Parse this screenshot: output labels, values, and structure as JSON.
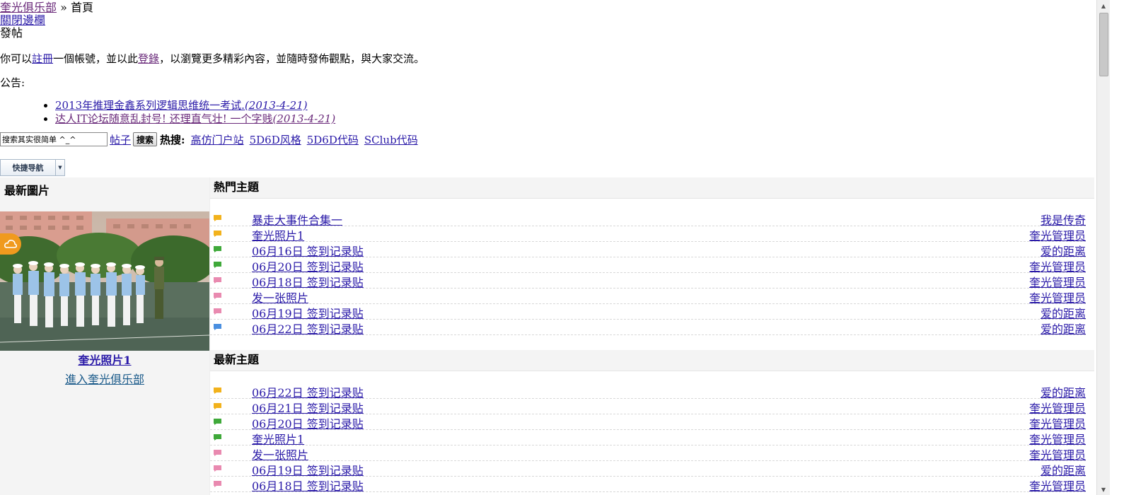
{
  "breadcrumb": {
    "home": "奎光俱乐部",
    "separator": "»",
    "current": "首頁"
  },
  "top_links": {
    "close_sidebar": "關閉邊欄",
    "post": "發帖"
  },
  "welcome": {
    "before": "你可以",
    "register": "註冊",
    "middle": "一個帳號，並以此",
    "login": "登錄",
    "after": "，以瀏覽更多精彩內容，並隨時發佈觀點，與大家交流。"
  },
  "notice": {
    "label": "公告:",
    "items": [
      {
        "text": "2013年推理金鑫系列逻辑思维统一考试.",
        "date": "(2013-4-21)"
      },
      {
        "text": "达人IT论坛随意乱封号! 还理直气壮! 一个字贱",
        "date": "(2013-4-21)"
      }
    ]
  },
  "search": {
    "value": "搜索其实很简单 ^_^",
    "scope": "帖子",
    "button": "搜索",
    "hot_label": "热搜:",
    "hot_terms": [
      "高仿门户站",
      "5D6D风格",
      "5D6D代码",
      "SClub代码"
    ]
  },
  "quick_nav": {
    "label": "快捷导航"
  },
  "left_panel": {
    "title": "最新圖片",
    "photo_caption": "奎光照片1",
    "enter_link": "進入奎光俱乐部"
  },
  "hot_topics": {
    "title": "熱門主題",
    "rows": [
      {
        "title": "暴走大事件合集一",
        "author": "我是传奇",
        "icon_color": "#f2b21c"
      },
      {
        "title": "奎光照片1",
        "author": "奎光管理员",
        "icon_color": "#f2b21c"
      },
      {
        "title": "06月16日 签到记录贴",
        "author": "爱的距离",
        "icon_color": "#3fa93a"
      },
      {
        "title": "06月20日 签到记录贴",
        "author": "奎光管理员",
        "icon_color": "#3fa93a"
      },
      {
        "title": "06月18日 签到记录贴",
        "author": "奎光管理员",
        "icon_color": "#e98ab0"
      },
      {
        "title": "发一张照片",
        "author": "奎光管理员",
        "icon_color": "#e98ab0"
      },
      {
        "title": "06月19日 签到记录贴",
        "author": "爱的距离",
        "icon_color": "#e98ab0"
      },
      {
        "title": "06月22日 签到记录贴",
        "author": "爱的距离",
        "icon_color": "#4a8fe0"
      }
    ]
  },
  "new_topics": {
    "title": "最新主題",
    "rows": [
      {
        "title": "06月22日 签到记录贴",
        "author": "爱的距离",
        "icon_color": "#f2b21c"
      },
      {
        "title": "06月21日 签到记录贴",
        "author": "奎光管理员",
        "icon_color": "#f2b21c"
      },
      {
        "title": "06月20日 签到记录贴",
        "author": "奎光管理员",
        "icon_color": "#3fa93a"
      },
      {
        "title": "奎光照片1",
        "author": "奎光管理员",
        "icon_color": "#3fa93a"
      },
      {
        "title": "发一张照片",
        "author": "奎光管理员",
        "icon_color": "#e98ab0"
      },
      {
        "title": "06月19日 签到记录贴",
        "author": "爱的距离",
        "icon_color": "#e98ab0"
      },
      {
        "title": "06月18日 签到记录贴",
        "author": "奎光管理员",
        "icon_color": "#e98ab0"
      }
    ]
  }
}
